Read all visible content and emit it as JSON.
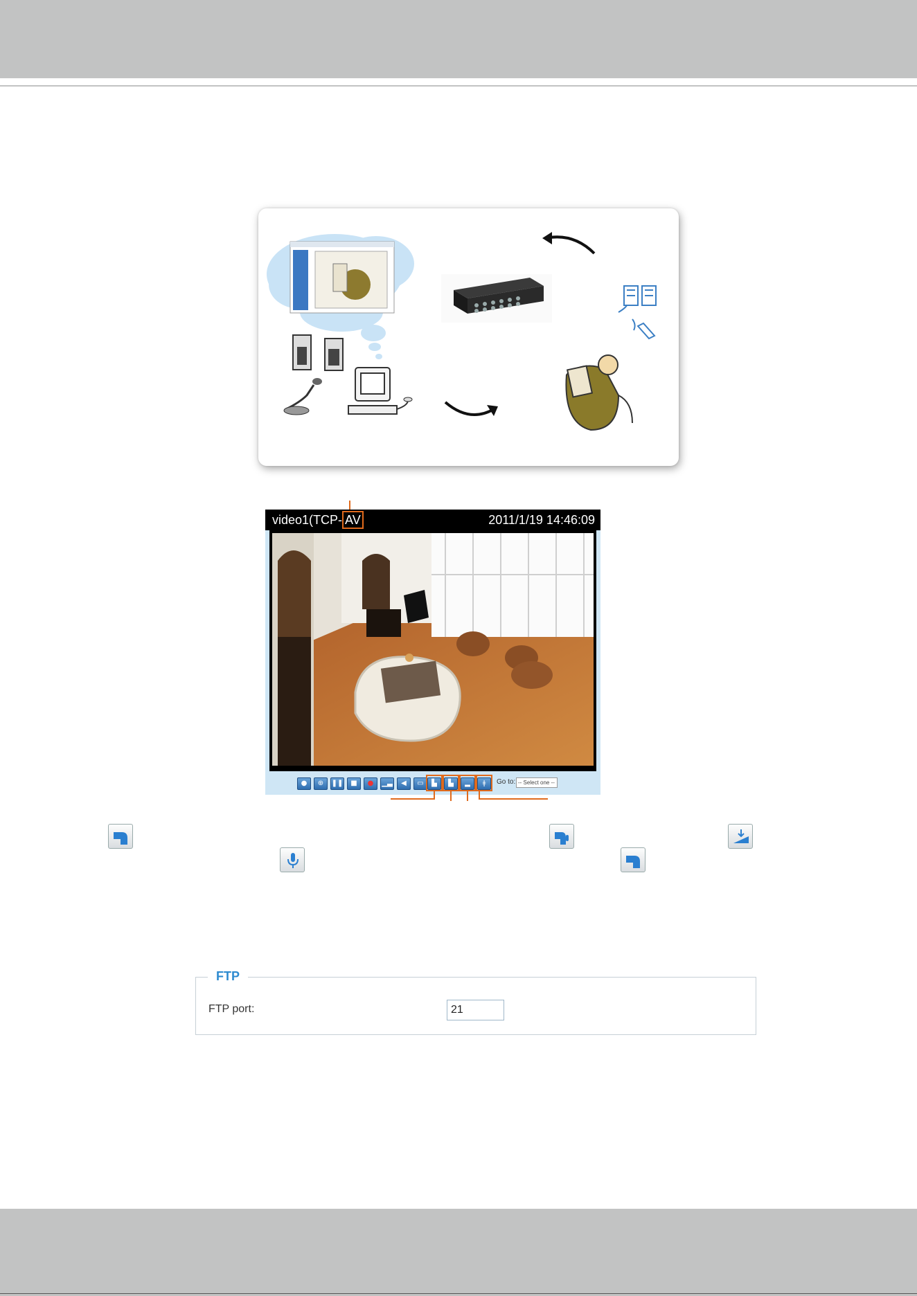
{
  "viewer": {
    "stream_label": "video1(TCP-",
    "protocol_mode": "AV",
    "timestamp": "2011/1/19 14:46:09",
    "goto_label": "Go to:",
    "goto_selected": "-- Select one --",
    "toolbar_buttons": [
      "snapshot-icon",
      "digital-zoom-icon",
      "pause-icon",
      "stop-icon",
      "record-icon",
      "volume-icon",
      "mute-icon",
      "fullscreen-icon",
      "talk-icon",
      "talk-mic-icon",
      "speaker-icon",
      "mic-icon"
    ]
  },
  "inline_icons": [
    "talk-icon",
    "talk-mic-icon",
    "speaker-icon",
    "mic-icon",
    "talk-icon"
  ],
  "ftp": {
    "legend": "FTP",
    "port_label": "FTP port:",
    "port_value": "21"
  },
  "colors": {
    "band": "#c2c3c3",
    "highlight": "#e06a1c",
    "accent": "#2e8bd0"
  }
}
